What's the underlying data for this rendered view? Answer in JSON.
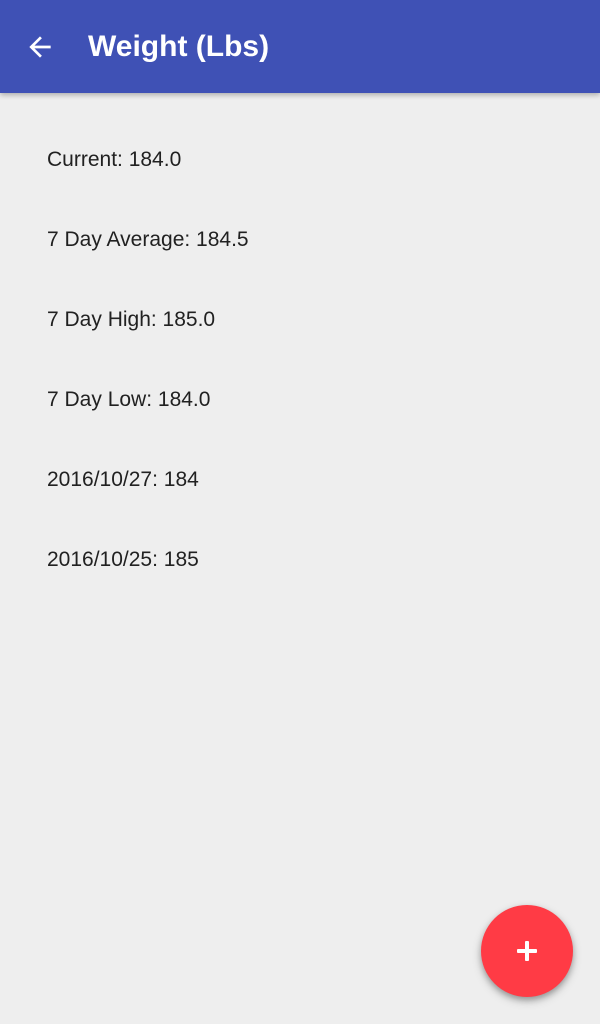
{
  "app_bar": {
    "title": "Weight (Lbs)",
    "back_icon": "arrow-back-icon",
    "background_color": "#3f51b5",
    "title_color": "#ffffff"
  },
  "stats": [
    {
      "label": "Current: 184.0"
    },
    {
      "label": "7 Day Average: 184.5"
    },
    {
      "label": "7 Day High: 185.0"
    },
    {
      "label": "7 Day Low: 184.0"
    },
    {
      "label": "2016/10/27: 184"
    },
    {
      "label": "2016/10/25: 185"
    }
  ],
  "fab": {
    "icon": "plus-icon",
    "background_color": "#ff3b45",
    "icon_color": "#ffffff"
  },
  "colors": {
    "background": "#eeeeee",
    "text": "#212121"
  }
}
